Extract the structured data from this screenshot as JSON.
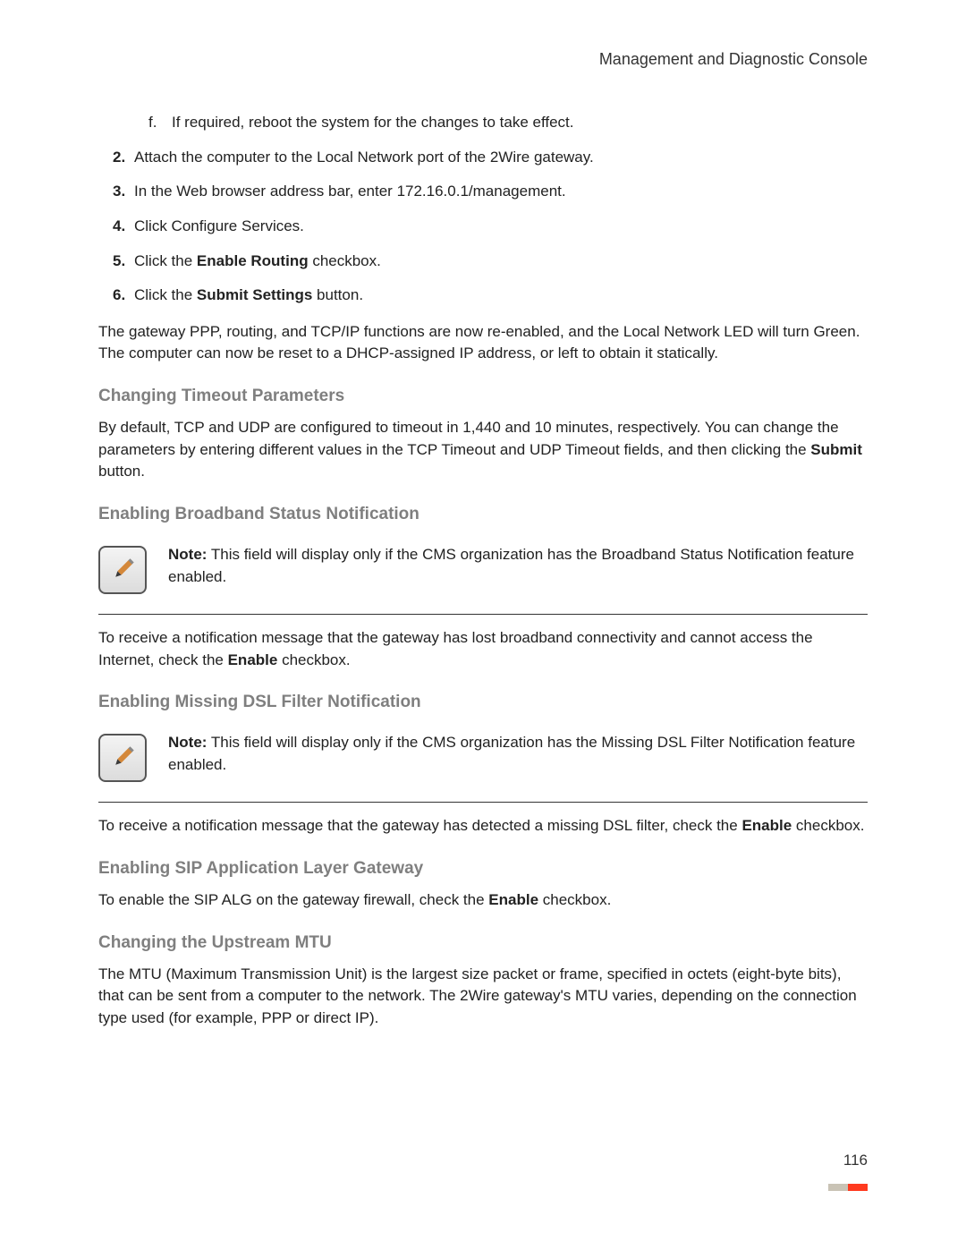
{
  "header": {
    "title": "Management and Diagnostic Console"
  },
  "steps": {
    "sub_f_marker": "f.",
    "sub_f_text": "If required, reboot the system for the changes to take effect.",
    "n2_num": "2.",
    "n2_text": "Attach the computer to the Local Network port of the 2Wire gateway.",
    "n3_num": "3.",
    "n3_text": "In the Web browser address bar, enter 172.16.0.1/management.",
    "n4_num": "4.",
    "n4_text": "Click Configure Services.",
    "n5_num": "5.",
    "n5_pre": "Click the ",
    "n5_bold": "Enable Routing",
    "n5_post": " checkbox.",
    "n6_num": "6.",
    "n6_pre": "Click the ",
    "n6_bold": "Submit Settings",
    "n6_post": " button."
  },
  "gateway_para": "The gateway PPP, routing, and TCP/IP functions are now re-enabled, and the Local Network LED will turn Green. The computer can now be reset to a DHCP-assigned IP address, or left to obtain it statically.",
  "section_timeout": {
    "heading": "Changing Timeout Parameters",
    "body_pre": "By default, TCP and UDP are configured to timeout in 1,440 and 10 minutes, respectively. You can change the parameters by entering different values in the TCP Timeout and UDP Timeout fields, and then clicking the ",
    "body_bold": "Submit",
    "body_post": " button."
  },
  "section_broadband": {
    "heading": "Enabling Broadband Status Notification",
    "note_label": "Note:",
    "note_text": " This field will display only if the CMS organization has the Broadband Status Notification feature enabled.",
    "body_pre": "To receive a notification message that the gateway has lost broadband connectivity and cannot access the Internet, check the ",
    "body_bold": "Enable",
    "body_post": " checkbox."
  },
  "section_dslfilter": {
    "heading": "Enabling Missing DSL Filter Notification",
    "note_label": "Note:",
    "note_text": " This field will display only if the CMS organization has the Missing DSL Filter Notification feature enabled.",
    "body_pre": "To receive a notification message that the gateway has detected a missing DSL filter, check the ",
    "body_bold": "Enable",
    "body_post": " checkbox."
  },
  "section_sip": {
    "heading": "Enabling SIP Application Layer Gateway",
    "body_pre": "To enable the SIP ALG on the gateway firewall, check the ",
    "body_bold": "Enable",
    "body_post": " checkbox."
  },
  "section_mtu": {
    "heading": "Changing the Upstream MTU",
    "body": "The MTU (Maximum Transmission Unit) is the largest size packet or frame, specified in octets (eight-byte bits), that can be sent from a computer to the network. The 2Wire gateway's MTU varies, depending on the connection type used (for example, PPP or direct IP)."
  },
  "page_number": "116",
  "footer_colors": {
    "seg1": "#c9c3b5",
    "seg2": "#ff3a1f"
  },
  "icon_colors": {
    "pencil": "#d4883a",
    "tip": "#3a3a3a"
  }
}
